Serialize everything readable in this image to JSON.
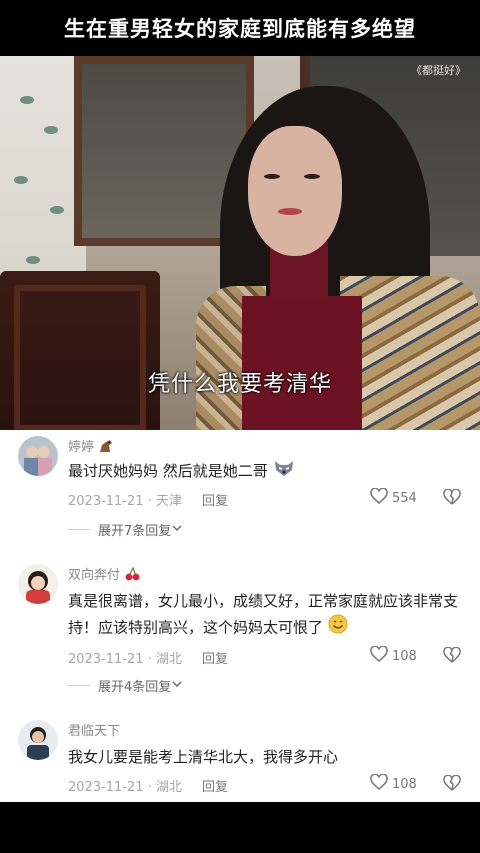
{
  "header": {
    "title": "生在重男轻女的家庭到底能有多绝望"
  },
  "video": {
    "watermark": "《都挺好》",
    "subtitle": "凭什么我要考清华"
  },
  "comments": [
    {
      "username": "婷婷",
      "username_emoji": "horse-emoji",
      "text": "最讨厌她妈妈 然后就是她二哥",
      "text_emoji": "wolf-emoji",
      "date": "2023-11-21",
      "location": "天津",
      "reply_label": "回复",
      "likes": "554",
      "expand_label": "展开7条回复"
    },
    {
      "username": "双向奔付",
      "username_emoji": "cherry-emoji",
      "text": "真是很离谱，女儿最小，成绩又好，正常家庭就应该非常支持！应该特别高兴，这个妈妈太可恨了",
      "text_emoji": "smile-emoji",
      "date": "2023-11-21",
      "location": "湖北",
      "reply_label": "回复",
      "likes": "108",
      "expand_label": "展开4条回复"
    },
    {
      "username": "君临天下",
      "text": "我女儿要是能考上清华北大，我得多开心",
      "date": "2023-11-21",
      "location": "湖北",
      "reply_label": "回复",
      "likes": "108"
    }
  ],
  "colors": {
    "accent_text": "#222222",
    "meta_text": "#a6a6a6",
    "background": "#ffffff"
  }
}
